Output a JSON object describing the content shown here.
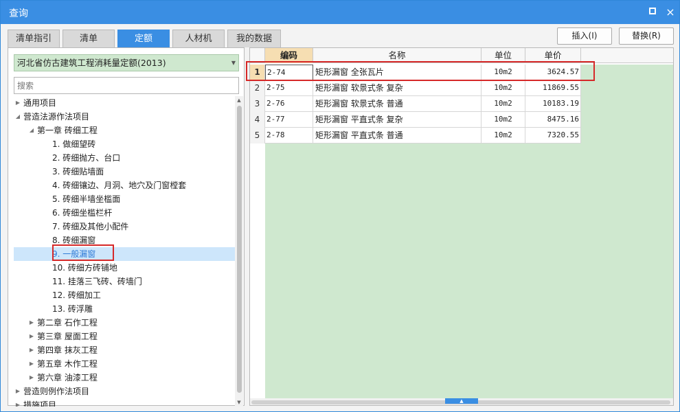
{
  "window": {
    "title": "查询",
    "maximize_icon": "maximize-icon",
    "close_label": "×"
  },
  "tabs": [
    {
      "label": "清单指引",
      "active": false
    },
    {
      "label": "清单",
      "active": false
    },
    {
      "label": "定额",
      "active": true
    },
    {
      "label": "人材机",
      "active": false
    },
    {
      "label": "我的数据",
      "active": false
    }
  ],
  "actions": {
    "insert_label": "插入(I)",
    "replace_label": "替换(R)"
  },
  "left": {
    "combo_value": "河北省仿古建筑工程消耗量定额(2013)",
    "search_placeholder": "搜索",
    "tree": [
      {
        "label": "通用项目",
        "level": 0,
        "toggle": "collapsed"
      },
      {
        "label": "营造法源作法项目",
        "level": 0,
        "toggle": "expanded"
      },
      {
        "label": "第一章 砖细工程",
        "level": 1,
        "toggle": "expanded"
      },
      {
        "label": "1. 做细望砖",
        "level": 2,
        "toggle": "none"
      },
      {
        "label": "2. 砖细抛方、台口",
        "level": 2,
        "toggle": "none"
      },
      {
        "label": "3. 砖细贴墙面",
        "level": 2,
        "toggle": "none"
      },
      {
        "label": "4. 砖细镶边、月洞、地穴及门窗樘套",
        "level": 2,
        "toggle": "none"
      },
      {
        "label": "5. 砖细半墙坐槛面",
        "level": 2,
        "toggle": "none"
      },
      {
        "label": "6. 砖细坐槛栏杆",
        "level": 2,
        "toggle": "none"
      },
      {
        "label": "7. 砖细及其他小配件",
        "level": 2,
        "toggle": "none"
      },
      {
        "label": "8. 砖细漏窗",
        "level": 2,
        "toggle": "none"
      },
      {
        "label": "9. 一般漏窗",
        "level": 2,
        "toggle": "none",
        "selected": true
      },
      {
        "label": "10. 砖细方砖铺地",
        "level": 2,
        "toggle": "none"
      },
      {
        "label": "11. 挂落三飞砖、砖墙门",
        "level": 2,
        "toggle": "none"
      },
      {
        "label": "12. 砖细加工",
        "level": 2,
        "toggle": "none"
      },
      {
        "label": "13. 砖浮雕",
        "level": 2,
        "toggle": "none"
      },
      {
        "label": "第二章 石作工程",
        "level": 1,
        "toggle": "collapsed"
      },
      {
        "label": "第三章 屋面工程",
        "level": 1,
        "toggle": "collapsed"
      },
      {
        "label": "第四章 抹灰工程",
        "level": 1,
        "toggle": "collapsed"
      },
      {
        "label": "第五章 木作工程",
        "level": 1,
        "toggle": "collapsed"
      },
      {
        "label": "第六章 油漆工程",
        "level": 1,
        "toggle": "collapsed"
      },
      {
        "label": "营造则例作法项目",
        "level": 0,
        "toggle": "collapsed"
      },
      {
        "label": "措施项目",
        "level": 0,
        "toggle": "collapsed"
      }
    ]
  },
  "grid": {
    "headers": {
      "code": "编码",
      "name": "名称",
      "unit": "单位",
      "price": "单价"
    },
    "rows": [
      {
        "num": "1",
        "code": "2-74",
        "name": "矩形漏窗 全张瓦片",
        "unit": "10m2",
        "price": "3624.57",
        "active": true
      },
      {
        "num": "2",
        "code": "2-75",
        "name": "矩形漏窗 软景式条 复杂",
        "unit": "10m2",
        "price": "11869.55"
      },
      {
        "num": "3",
        "code": "2-76",
        "name": "矩形漏窗 软景式条 普通",
        "unit": "10m2",
        "price": "10183.19"
      },
      {
        "num": "4",
        "code": "2-77",
        "name": "矩形漏窗 平直式条 复杂",
        "unit": "10m2",
        "price": "8475.16"
      },
      {
        "num": "5",
        "code": "2-78",
        "name": "矩形漏窗 平直式条 普通",
        "unit": "10m2",
        "price": "7320.55"
      }
    ]
  },
  "colors": {
    "titlebar": "#3a8ee3",
    "active_tab": "#3a8ee3",
    "grid_background": "#cfe8cf",
    "header_code": "#f6deb2",
    "selected_tree": "#cde6fb",
    "annotation": "#d62828"
  }
}
